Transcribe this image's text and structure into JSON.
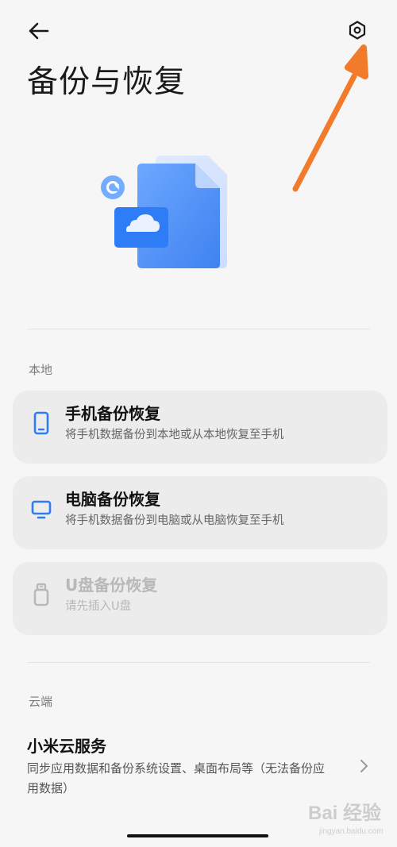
{
  "header": {
    "title": "备份与恢复",
    "back_icon": "arrow-left-icon",
    "settings_icon": "gear-icon"
  },
  "colors": {
    "accent": "#2f7df6",
    "arrow": "#f27a2b",
    "disabled": "#b8b8b8"
  },
  "sections": {
    "local": {
      "label": "本地",
      "items": [
        {
          "title": "手机备份恢复",
          "subtitle": "将手机数据备份到本地或从本地恢复至手机",
          "icon": "phone-icon"
        },
        {
          "title": "电脑备份恢复",
          "subtitle": "将手机数据备份到电脑或从电脑恢复至手机",
          "icon": "monitor-icon"
        },
        {
          "title": "U盘备份恢复",
          "subtitle": "请先插入U盘",
          "icon": "usb-drive-icon"
        }
      ]
    },
    "cloud": {
      "label": "云端",
      "item": {
        "title": "小米云服务",
        "description": "同步应用数据和备份系统设置、桌面布局等（无法备份应用数据）",
        "icon": "chevron-right-icon"
      }
    }
  },
  "watermark": {
    "text": "Bai 经验",
    "subtext": "jingyan.baidu.com"
  }
}
